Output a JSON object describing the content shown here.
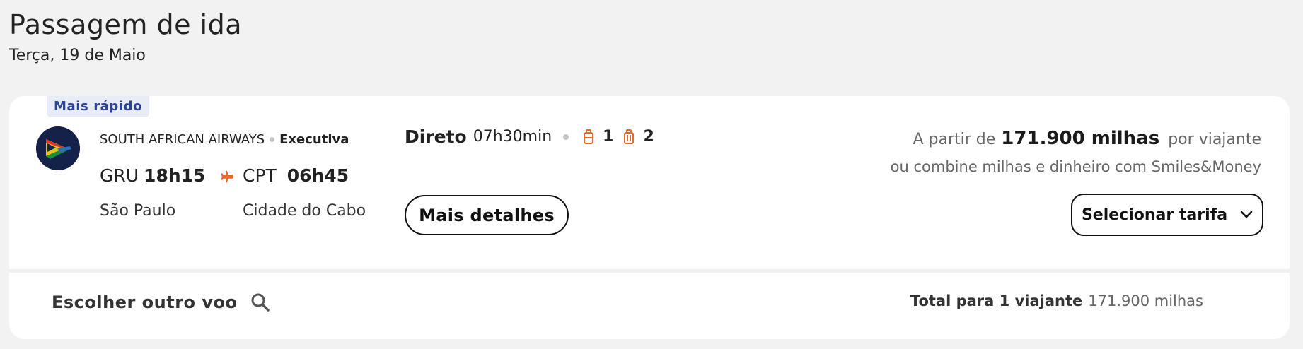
{
  "header": {
    "title": "Passagem de ida",
    "date": "Terça, 19 de Maio"
  },
  "flight": {
    "badge": "Mais rápido",
    "airline": "SOUTH AFRICAN AIRWAYS",
    "cabin": "Executiva",
    "origin": {
      "code": "GRU",
      "time": "18h15",
      "city": "São Paulo"
    },
    "destination": {
      "code": "CPT",
      "time": "06h45",
      "city": "Cidade do Cabo"
    },
    "type": "Direto",
    "duration": "07h30min",
    "bags": {
      "carry_on_count": "1",
      "checked_count": "2"
    },
    "details_label": "Mais detalhes"
  },
  "pricing": {
    "from_label": "A partir de",
    "price": "171.900 milhas",
    "per_label": "por viajante",
    "combine_text": "ou combine milhas e dinheiro com Smiles&Money",
    "select_label": "Selecionar tarifa"
  },
  "footer": {
    "other_flight_label": "Escolher outro voo",
    "total_label": "Total para 1 viajante",
    "total_value": "171.900 milhas"
  },
  "colors": {
    "accent_orange": "#e8662a",
    "badge_text": "#2a4596",
    "badge_bg": "#e8ecf7",
    "logo_bg": "#14224a"
  },
  "icons": [
    "airline-logo",
    "plane-icon",
    "carry-on-bag-icon",
    "checked-bag-icon",
    "chevron-down-icon",
    "search-icon"
  ]
}
